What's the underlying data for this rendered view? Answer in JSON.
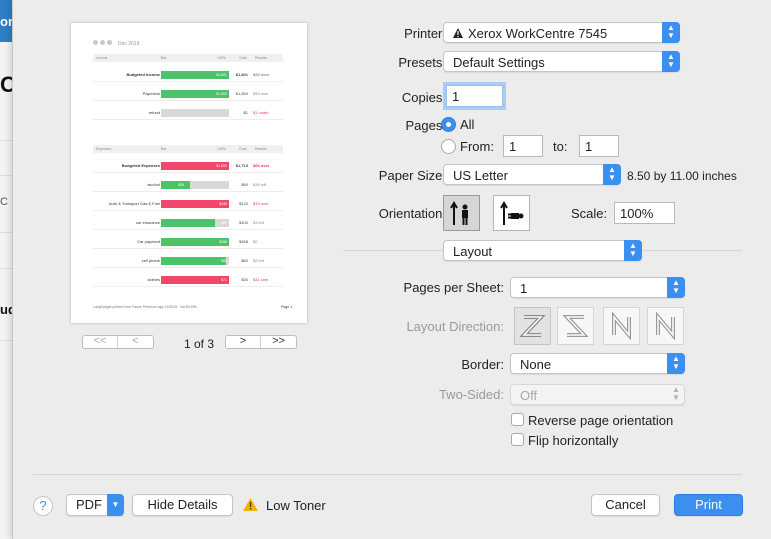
{
  "background_app": {
    "topbar_text": "or",
    "big_text": "C",
    "small_text": "C",
    "bold_text": "ud"
  },
  "preview": {
    "month": "Dec 2019",
    "income_header": [
      "Income",
      "Bar",
      "100%",
      "Goal",
      "Results"
    ],
    "expense_header": [
      "Expenses",
      "Bar",
      "100%",
      "Goal",
      "Results"
    ],
    "income_rows": [
      {
        "name": "Budgeted Income",
        "bold": true,
        "bar_value": "$1,801",
        "fill": 1.0,
        "color": "#4cc26a",
        "goal": "$1,801",
        "result": "$53 over",
        "result_color": "#888"
      },
      {
        "name": "Paycheck",
        "bold": false,
        "bar_value": "$1,800",
        "fill": 1.0,
        "color": "#4cc26a",
        "goal": "$1,800",
        "result": "$54 over",
        "result_color": "#888"
      },
      {
        "name": "refund",
        "bold": false,
        "bar_value": "",
        "fill": 0.0,
        "color": "#4cc26a",
        "goal": "$1",
        "result": "$1 under",
        "result_color": "#e23b55"
      }
    ],
    "expense_rows": [
      {
        "name": "Budgeted Expenses",
        "bold": true,
        "bar_value": "$1,650",
        "fill": 1.0,
        "color": "#f2466a",
        "goal": "$1,713",
        "result": "$66 over",
        "result_color": "#e23b55"
      },
      {
        "name": "alcohol",
        "bold": false,
        "bar_value": "$26",
        "fill": 0.43,
        "color": "#4cc26a",
        "goal": "$60",
        "result": "$34 left",
        "result_color": "#888"
      },
      {
        "name": "Auto & Transport Gas & Fuel",
        "bold": false,
        "bar_value": "$135",
        "fill": 1.0,
        "color": "#f2466a",
        "goal": "$120",
        "result": "$15 over",
        "result_color": "#e23b55"
      },
      {
        "name": "car insurance",
        "bold": false,
        "bar_value": "$97",
        "fill": 0.8,
        "color": "#4cc26a",
        "goal": "$100",
        "result": "$3 left",
        "result_color": "#888"
      },
      {
        "name": "Car payment",
        "bold": false,
        "bar_value": "$458",
        "fill": 1.0,
        "color": "#4cc26a",
        "goal": "$458",
        "result": "$0",
        "result_color": "#888"
      },
      {
        "name": "cell phone",
        "bold": false,
        "bar_value": "$58",
        "fill": 0.95,
        "color": "#4cc26a",
        "goal": "$60",
        "result": "$2 left",
        "result_color": "#888"
      },
      {
        "name": "clothes",
        "bold": false,
        "bar_value": "$71",
        "fill": 1.0,
        "color": "#f2466a",
        "goal": "$30",
        "result": "$41 over",
        "result_color": "#e23b55"
      }
    ],
    "footer_left": "LazyBudget  printed from Fauxe Premium app  12/2019 · via $9,999",
    "footer_right": "Page 1",
    "page_indicator": "1 of 3",
    "nav_first": "<<",
    "nav_prev": "<",
    "nav_next": ">",
    "nav_last": ">>"
  },
  "form": {
    "printer_label": "Printer:",
    "printer_value": "Xerox WorkCentre 7545",
    "presets_label": "Presets:",
    "presets_value": "Default Settings",
    "copies_label": "Copies:",
    "copies_value": "1",
    "pages_label": "Pages:",
    "pages_all": "All",
    "pages_from": "From:",
    "pages_from_value": "1",
    "pages_to": "to:",
    "pages_to_value": "1",
    "paper_size_label": "Paper Size:",
    "paper_size_value": "US Letter",
    "paper_dimensions": "8.50 by 11.00 inches",
    "orientation_label": "Orientation:",
    "scale_label": "Scale:",
    "scale_value": "100%",
    "section_value": "Layout",
    "pages_per_sheet_label": "Pages per Sheet:",
    "pages_per_sheet_value": "1",
    "layout_direction_label": "Layout Direction:",
    "border_label": "Border:",
    "border_value": "None",
    "two_sided_label": "Two-Sided:",
    "two_sided_value": "Off",
    "reverse_label": "Reverse page orientation",
    "flip_label": "Flip horizontally"
  },
  "footer": {
    "help": "?",
    "pdf": "PDF",
    "hide_details": "Hide Details",
    "low_toner": "Low Toner",
    "cancel": "Cancel",
    "print": "Print"
  },
  "colors": {
    "accent": "#3b8ff0",
    "green_bar": "#4cc26a",
    "red_bar": "#f2466a",
    "warning": "#f2b400"
  },
  "icons": {
    "printer_status": "warning-triangle-icon",
    "low_toner": "warning-triangle-icon",
    "popup_arrows": "up-down-chevron-icon"
  }
}
